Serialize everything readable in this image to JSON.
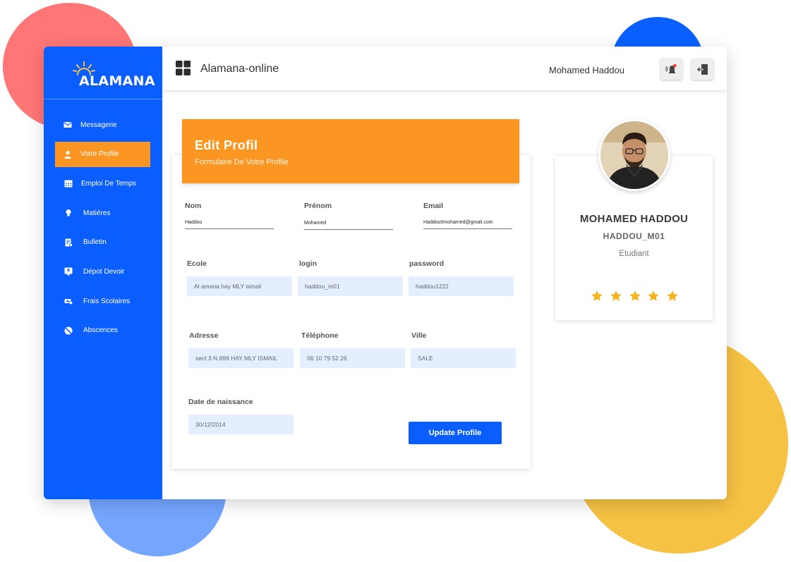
{
  "brand": {
    "logo_text": "ALAMANA"
  },
  "header": {
    "app_title": "Alamana-online",
    "user_name": "Mohamed Haddou",
    "notification_icon": "notification-bell-icon",
    "logout_icon": "logout-icon"
  },
  "sidebar": {
    "items": [
      {
        "label": "Messagerie",
        "icon": "mail-icon",
        "active": false
      },
      {
        "label": "Votre Profile",
        "icon": "user-icon",
        "active": true
      },
      {
        "label": "Emploi De Temps",
        "icon": "calendar-icon",
        "active": false
      },
      {
        "label": "Matiéres",
        "icon": "lightbulb-icon",
        "active": false
      },
      {
        "label": "Bulletin",
        "icon": "report-icon",
        "active": false
      },
      {
        "label": "Dépot Devoir",
        "icon": "upload-icon",
        "active": false
      },
      {
        "label": "Frais Scolaires",
        "icon": "money-icon",
        "active": false
      },
      {
        "label": "Abscences",
        "icon": "block-icon",
        "active": false
      }
    ]
  },
  "form": {
    "title": "Edit Profil",
    "subtitle": "Formulaire De Votre Profile",
    "fields": {
      "nom": {
        "label": "Nom",
        "value": "Haddou"
      },
      "prenom": {
        "label": "Prénom",
        "value": "Mohamed"
      },
      "email": {
        "label": "Email",
        "value": "Haddou0mohamed@gmail.com"
      },
      "ecole": {
        "label": "Ecole",
        "value": "Al amana hay MLY ismail"
      },
      "login": {
        "label": "login",
        "value": "haddou_m01"
      },
      "password": {
        "label": "password",
        "value": "haddou1221"
      },
      "adresse": {
        "label": "Adresse",
        "value": "sect 3 N 899 HAY MLY ISMAIL"
      },
      "telephone": {
        "label": "Téléphone",
        "value": "06 10 79 52 26"
      },
      "ville": {
        "label": "Ville",
        "value": "SALE"
      },
      "date_naissance": {
        "label": "Date de naissance",
        "value": "30/12/2014"
      }
    },
    "submit_label": "Update Profile"
  },
  "profile": {
    "name": "MOHAMED HADDOU",
    "login": "HADDOU_M01",
    "role": "Etudiant",
    "rating": 5,
    "rating_max": 5
  },
  "colors": {
    "primary": "#0a5eff",
    "accent": "#fc9623",
    "star": "#f6b21f",
    "field_bg": "#e3eeff"
  }
}
